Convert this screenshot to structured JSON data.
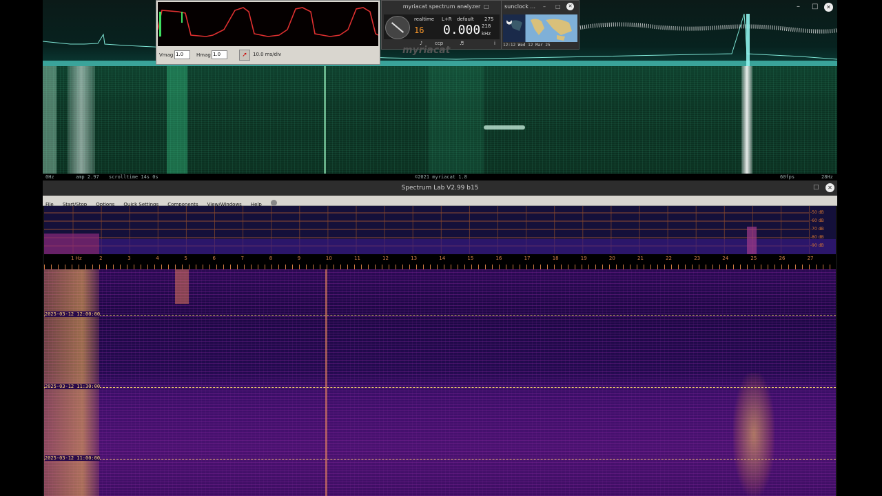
{
  "myriacat": {
    "title": "myriacat spectrum analyzer",
    "mode": "realtime",
    "channel": "L+R",
    "preset": "default",
    "preset_value": "275",
    "level_digits": "16",
    "frequency": "0.000",
    "freq_small": "218",
    "freq_unit": "kHz",
    "btn_1": "♪",
    "btn_2": "ccp",
    "btn_3": "♬",
    "btn_4": "i",
    "watermark": "myriacat",
    "status_left_freq": "0Hz",
    "status_amp": "amp 2.97",
    "status_scroll": "scrolltime 14s 0s",
    "status_copyright": "©2021 myriacat 1.8",
    "status_fps": "60fps",
    "status_right_freq": "28Hz"
  },
  "scope": {
    "vmag_label": "Vmag",
    "vmag_value": "1.0",
    "hmag_label": "Hmag",
    "hmag_value": "1.0",
    "timebase": "10.0 ms/div"
  },
  "sunclock": {
    "title": "sunclock ...",
    "time": "12:12 Wed 12 Mar 25"
  },
  "spectrum_lab": {
    "title": "Spectrum Lab V2.99 b15",
    "menu": [
      "File",
      "Start/Stop",
      "Options",
      "Quick Settings",
      "Components",
      "View/Windows",
      "Help"
    ],
    "db_labels": [
      "-50 dB",
      "-60 dB",
      "-70 dB",
      "-80 dB",
      "-90 dB"
    ],
    "freq_ticks": [
      "1 Hz",
      "2",
      "3",
      "4",
      "5",
      "6",
      "7",
      "8",
      "9",
      "10",
      "11",
      "12",
      "13",
      "14",
      "15",
      "16",
      "17",
      "18",
      "19",
      "20",
      "21",
      "22",
      "23",
      "24",
      "25",
      "26",
      "27"
    ],
    "timestamps": [
      "2025-03-12 12:00:00",
      "2025-03-12 11:30:00",
      "2025-03-12 11:00:00"
    ]
  },
  "window_controls": {
    "minimize": "–",
    "maximize": "□",
    "close": "✕"
  }
}
